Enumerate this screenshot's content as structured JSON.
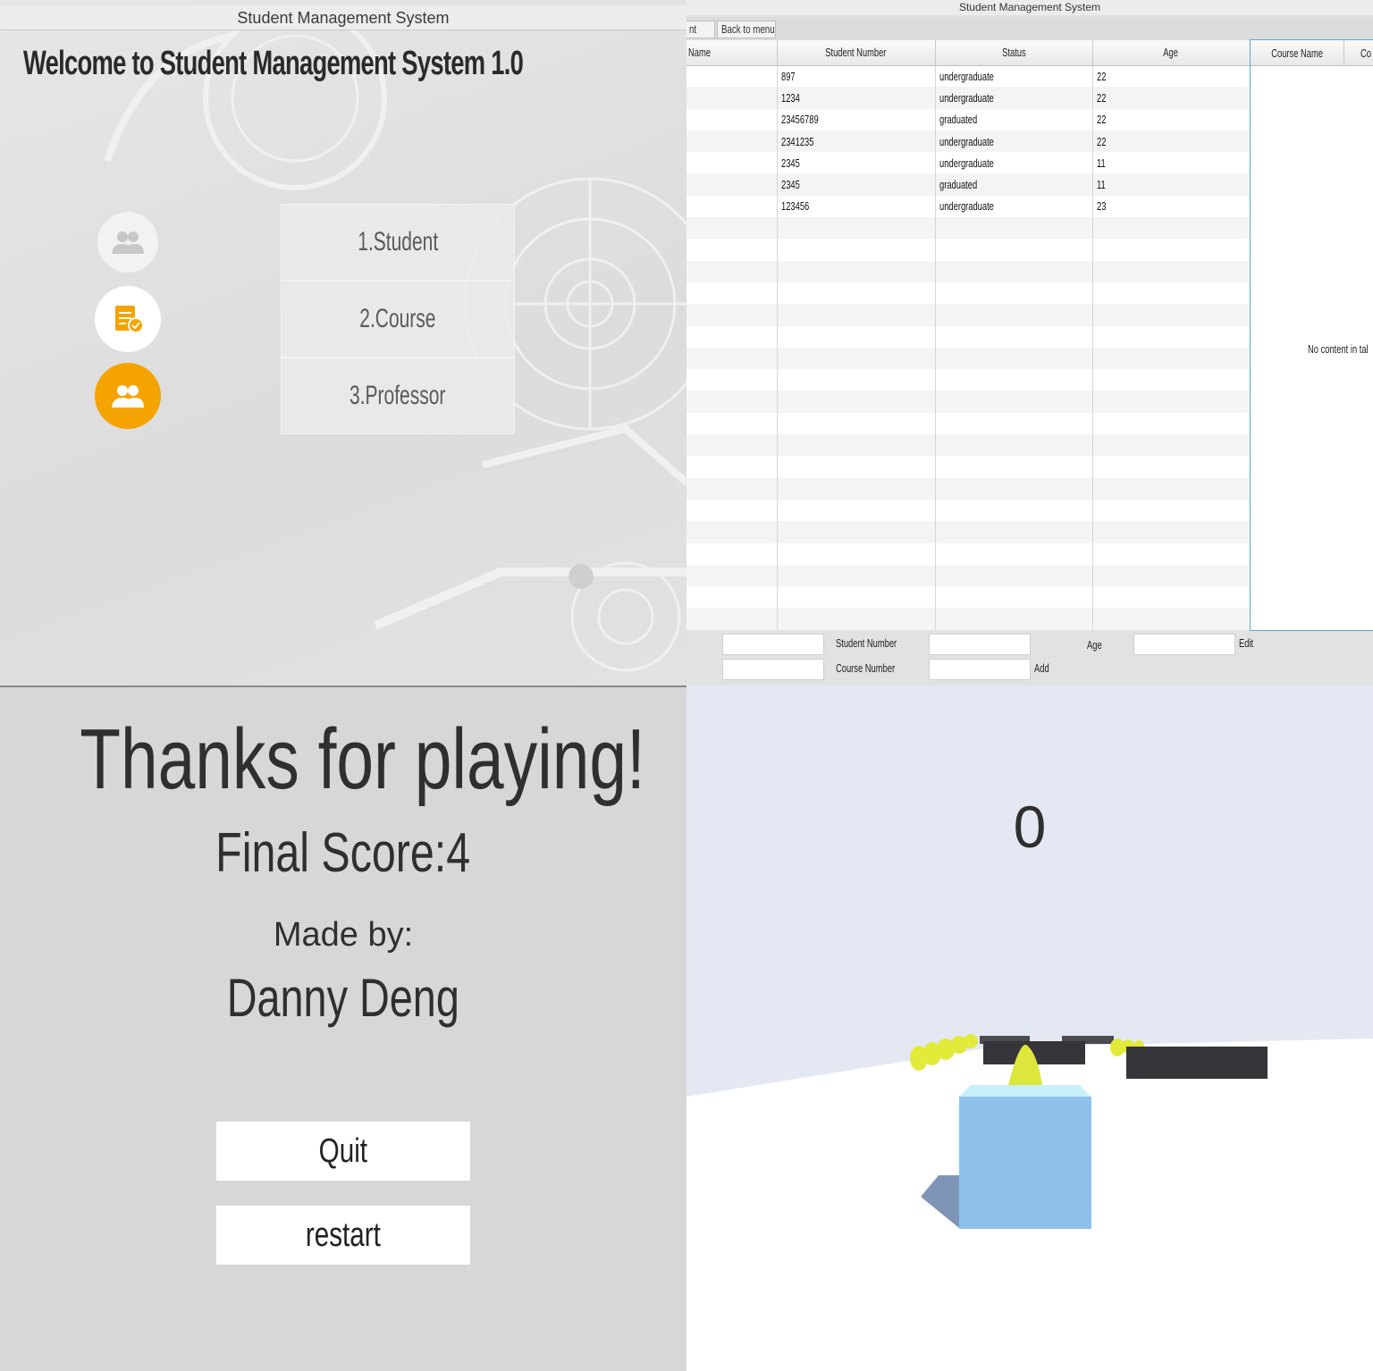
{
  "menu": {
    "window_title": "Student Management System",
    "welcome": "Welcome to Student Management System 1.0",
    "items": [
      {
        "label": "1.Student",
        "icon": "users-icon"
      },
      {
        "label": "2.Course",
        "icon": "course-document-icon"
      },
      {
        "label": "3.Professor",
        "icon": "professor-icon"
      }
    ],
    "colors": {
      "accent": "#f5a300"
    }
  },
  "students": {
    "window_title": "Student Management System",
    "toolbar": {
      "partial_label": "nt",
      "back_label": "Back to menu"
    },
    "columns": [
      "Name",
      "Student Number",
      "Status",
      "Age"
    ],
    "rows": [
      {
        "name": "",
        "number": "897",
        "status": "undergraduate",
        "age": "22"
      },
      {
        "name": "",
        "number": "1234",
        "status": "undergraduate",
        "age": "22"
      },
      {
        "name": "",
        "number": "23456789",
        "status": "graduated",
        "age": "22"
      },
      {
        "name": "",
        "number": "2341235",
        "status": "undergraduate",
        "age": "22"
      },
      {
        "name": "",
        "number": "2345",
        "status": "undergraduate",
        "age": "11"
      },
      {
        "name": "",
        "number": "2345",
        "status": "graduated",
        "age": "11"
      },
      {
        "name": "",
        "number": "123456",
        "status": "undergraduate",
        "age": "23"
      }
    ],
    "course_table": {
      "columns": [
        "Course Name",
        "Co"
      ],
      "empty_text": "No content in tal"
    },
    "form": {
      "student_number_label": "Student Number",
      "age_label": "Age",
      "edit_label": "Edit",
      "course_number_label": "Course Number",
      "add_label": "Add"
    }
  },
  "game_over": {
    "heading": "Thanks for playing!",
    "final_score": "Final Score:4",
    "made_by_label": "Made by:",
    "author": "Danny Deng",
    "quit_label": "Quit",
    "restart_label": "restart"
  },
  "game": {
    "score": "0",
    "colors": {
      "player": "#8ec2ea",
      "obstacle": "#3b3b3f",
      "collectible": "#e8ef4a"
    }
  }
}
